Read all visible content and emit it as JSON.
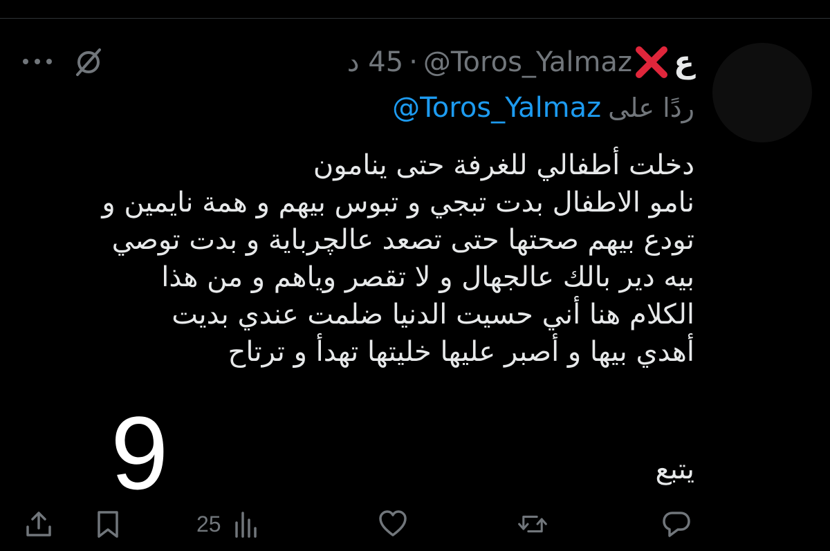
{
  "user": {
    "display_name": "ع",
    "handle": "@Toros_Yalmaz",
    "separator": "·",
    "time": "45 د"
  },
  "reply": {
    "prefix": "ردًا على",
    "handle": "@Toros_Yalmaz"
  },
  "tweet": {
    "lines": [
      "دخلت أطفالي للغرفة حتى ينامون",
      "نامو الاطفال بدت تبجي و تبوس بيهم و همة نايمين و",
      "تودع بيهم صحتها حتى تصعد عالچرباية و بدت توصي",
      "بيه دير بالك عالجهال و لا تقصر وياهم و من هذا",
      "الكلام هنا أني حسيت الدنيا ضلمت عندي بديت",
      "أهدي بيها و أصبر عليها خليتها تهدأ و ترتاح"
    ],
    "follow": "يتبع"
  },
  "overlay_number": "9",
  "actions": {
    "views_count": "25"
  },
  "colors": {
    "background": "#000000",
    "text": "#e7e9ea",
    "muted": "#71767b",
    "accent": "#1d9bf0",
    "cross": "#e0263b",
    "divider": "#2f3336"
  },
  "icons": {
    "more": "more-icon",
    "grok": "grok-icon",
    "name_emoji": "cross-mark-icon",
    "share": "share-icon",
    "bookmark": "bookmark-icon",
    "views": "views-icon",
    "like": "heart-icon",
    "retweet": "retweet-icon",
    "reply": "reply-icon"
  }
}
